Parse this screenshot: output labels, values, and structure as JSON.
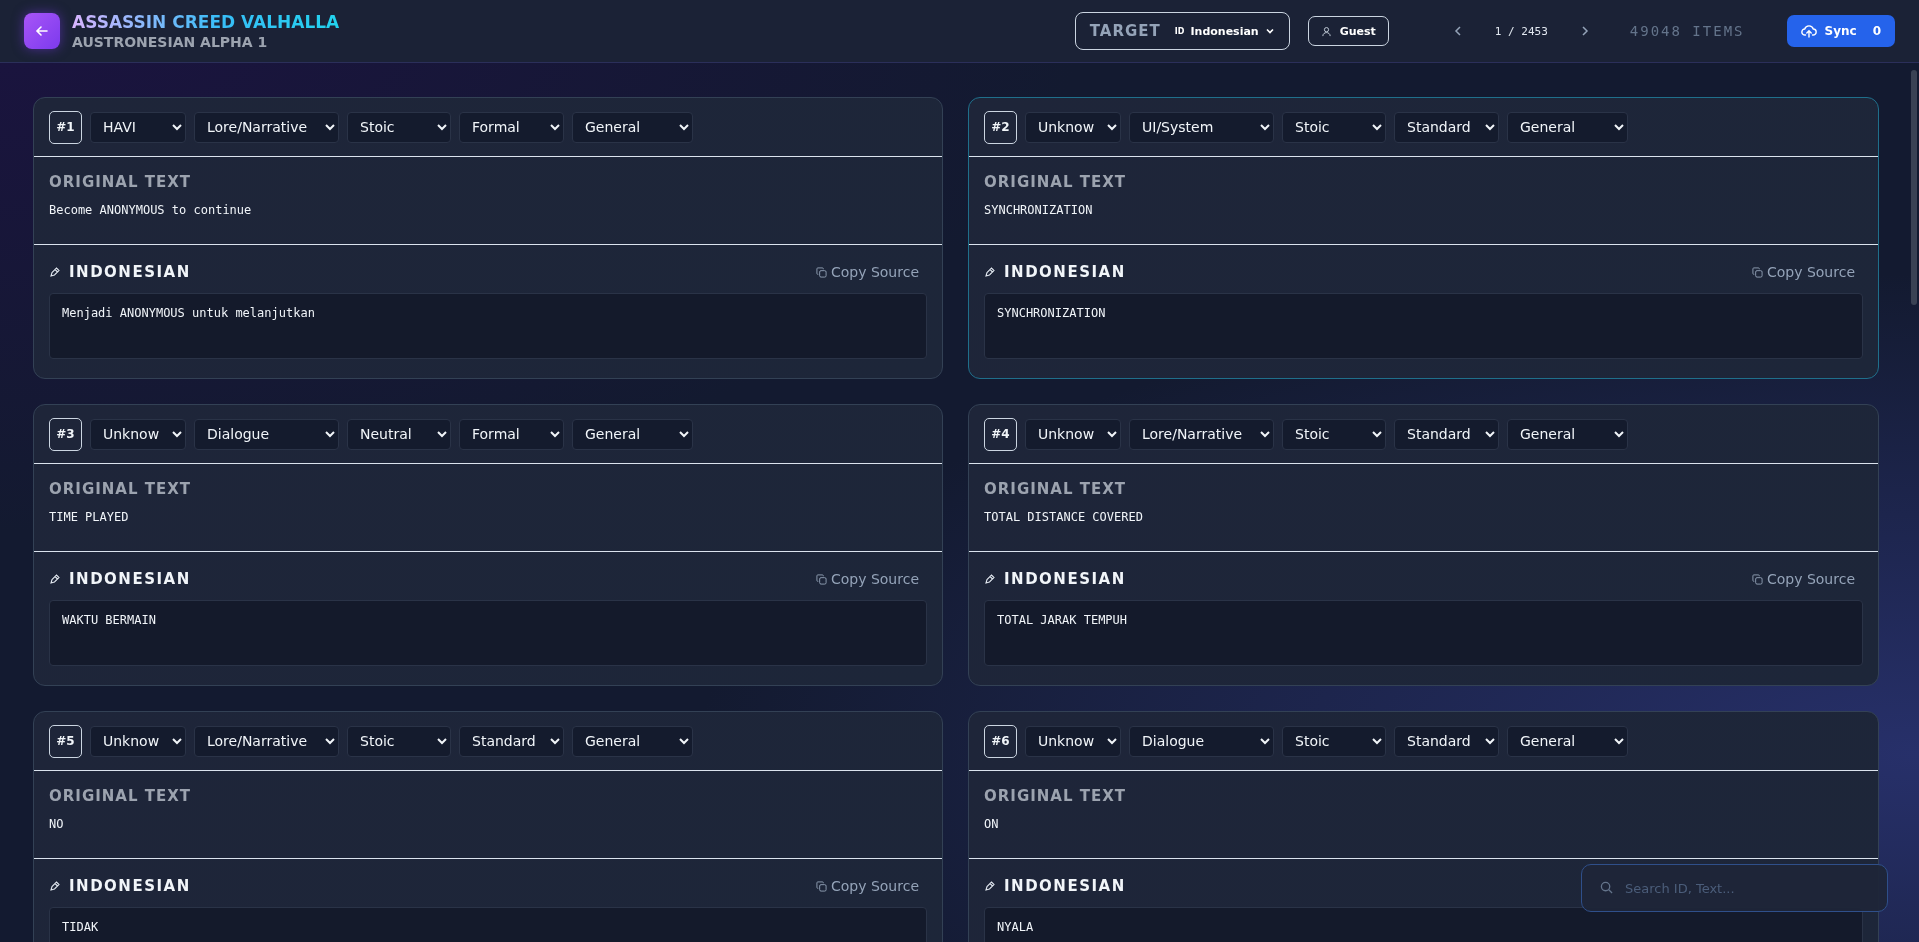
{
  "header": {
    "title": "ASSASSIN CREED VALHALLA",
    "subtitle": "AUSTRONESIAN ALPHA 1",
    "target_label": "TARGET",
    "flag": "ID",
    "language": "Indonesian",
    "user": "Guest",
    "page": "1 / 2453",
    "items": "49048 ITEMS",
    "sync_label": "Sync",
    "sync_count": "0"
  },
  "cards": [
    {
      "number": "#1",
      "highlighted": false,
      "tags": [
        "HAVI",
        "Lore/Narrative",
        "Stoic",
        "Formal",
        "General"
      ],
      "original_label": "ORIGINAL TEXT",
      "original": "Become ANONYMOUS to continue",
      "target_label": "INDONESIAN",
      "copy_label": "Copy Source",
      "translation": "Menjadi ANONYMOUS untuk melanjutkan"
    },
    {
      "number": "#2",
      "highlighted": true,
      "tags": [
        "Unknow",
        "UI/System",
        "Stoic",
        "Standard",
        "General"
      ],
      "original_label": "ORIGINAL TEXT",
      "original": "SYNCHRONIZATION",
      "target_label": "INDONESIAN",
      "copy_label": "Copy Source",
      "translation": "SYNCHRONIZATION"
    },
    {
      "number": "#3",
      "highlighted": false,
      "tags": [
        "Unknow",
        "Dialogue",
        "Neutral",
        "Formal",
        "General"
      ],
      "original_label": "ORIGINAL TEXT",
      "original": "TIME PLAYED",
      "target_label": "INDONESIAN",
      "copy_label": "Copy Source",
      "translation": "WAKTU BERMAIN"
    },
    {
      "number": "#4",
      "highlighted": false,
      "tags": [
        "Unknow",
        "Lore/Narrative",
        "Stoic",
        "Standard",
        "General"
      ],
      "original_label": "ORIGINAL TEXT",
      "original": "TOTAL DISTANCE COVERED",
      "target_label": "INDONESIAN",
      "copy_label": "Copy Source",
      "translation": "TOTAL JARAK TEMPUH"
    },
    {
      "number": "#5",
      "highlighted": false,
      "tags": [
        "Unknow",
        "Lore/Narrative",
        "Stoic",
        "Standard",
        "General"
      ],
      "original_label": "ORIGINAL TEXT",
      "original": "NO",
      "target_label": "INDONESIAN",
      "copy_label": "Copy Source",
      "translation": "TIDAK"
    },
    {
      "number": "#6",
      "highlighted": false,
      "tags": [
        "Unknow",
        "Dialogue",
        "Stoic",
        "Standard",
        "General"
      ],
      "original_label": "ORIGINAL TEXT",
      "original": "ON",
      "target_label": "INDONESIAN",
      "translation": "NYALA"
    }
  ],
  "search": {
    "placeholder": "Search ID, Text..."
  }
}
